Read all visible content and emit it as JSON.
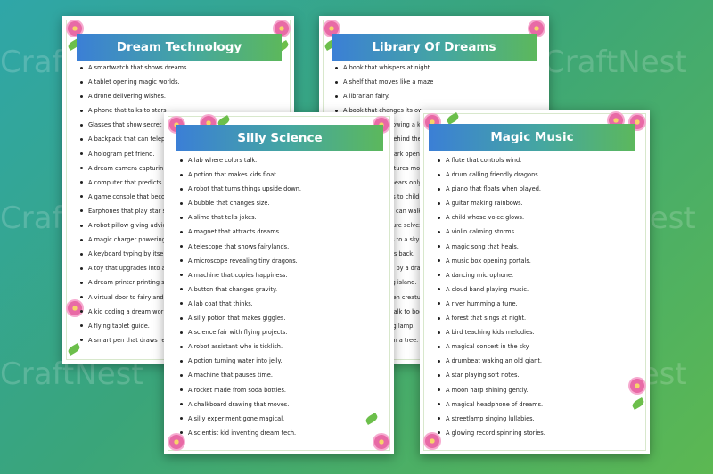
{
  "watermark": "CraftNest",
  "colors": {
    "title_left": "#3b7fd6",
    "title_right": "#5cb85c",
    "flower": "#e86aa6",
    "leaf": "#6cbf4b"
  },
  "sheets": [
    {
      "title": "Dream Technology",
      "items": [
        "A smartwatch that shows dreams.",
        "A tablet opening magic worlds.",
        "A drone delivering wishes.",
        "A phone that talks to stars",
        "Glasses that show secret",
        "A backpack that can telep",
        "A hologram pet friend.",
        "A dream camera capturin",
        "A computer that predicts",
        "A game console that beco",
        "Earphones that play star s",
        "A robot pillow giving advic",
        "A magic charger powering",
        "A keyboard typing by itself",
        "A toy that upgrades into a",
        "A dream printer printing st",
        "A virtual door to fairyland.",
        "A kid coding a dream worl",
        "A flying tablet guide.",
        "A smart pen that draws re"
      ]
    },
    {
      "title": "Library Of Dreams",
      "items": [
        "A book that whispers at night.",
        "A shelf that moves like a maze.",
        "A librarian fairy.",
        "A book that changes its ow",
        "A flying book following a ki",
        "A secret tunnel behind the",
        "A glowing bookmark open",
        "A book where pictures mo",
        "A library that appears only",
        "A chair that reads to childr",
        "A giant book kids can walk",
        "A book about future selves",
        "A shelf that leads to a sky c",
        "A book that writes back.",
        "A library guarded by a dra",
        "A floating reading island.",
        "A book of forgotten creatu",
        "A child who can talk to boo",
        "A magical reading lamp.",
        "A library hidden in a tree."
      ]
    },
    {
      "title": "Silly Science",
      "items": [
        "A lab where colors talk.",
        "A potion that makes kids float.",
        "A robot that turns things upside down.",
        "A bubble that changes size.",
        "A slime that tells jokes.",
        "A magnet that attracts dreams.",
        "A telescope that shows fairylands.",
        "A microscope revealing tiny dragons.",
        "A machine that copies happiness.",
        "A button that changes gravity.",
        "A lab coat that thinks.",
        "A silly potion that makes giggles.",
        "A science fair with flying projects.",
        "A robot assistant who is ticklish.",
        "A potion turning water into jelly.",
        "A machine that pauses time.",
        "A rocket made from soda bottles.",
        "A chalkboard drawing that moves.",
        "A silly experiment gone magical.",
        "A scientist kid inventing dream tech."
      ]
    },
    {
      "title": "Magic Music",
      "items": [
        "A flute that controls wind.",
        "A drum calling friendly dragons.",
        "A piano that floats when played.",
        "A guitar making rainbows.",
        "A child whose voice glows.",
        "A violin calming storms.",
        "A magic song that heals.",
        "A music box opening portals.",
        "A dancing microphone.",
        "A cloud band playing music.",
        "A river humming a tune.",
        "A forest that sings at night.",
        "A bird teaching kids melodies.",
        "A magical concert in the sky.",
        "A drumbeat waking an old giant.",
        "A star playing soft notes.",
        "A moon harp shining gently.",
        "A magical headphone of dreams.",
        "A streetlamp singing lullabies.",
        "A glowing record spinning stories."
      ]
    }
  ]
}
